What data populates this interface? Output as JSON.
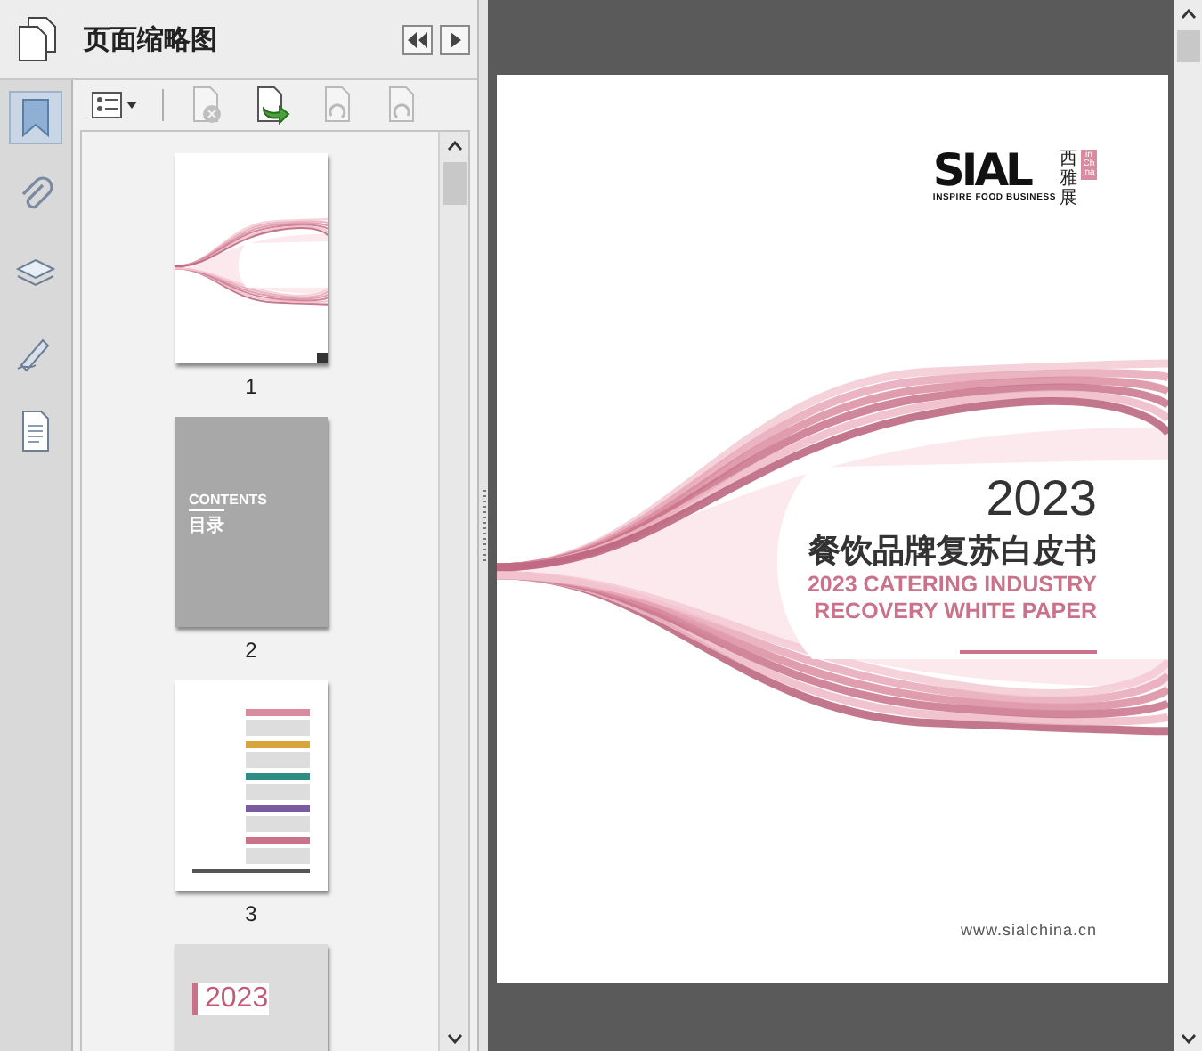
{
  "panel": {
    "title": "页面缩略图"
  },
  "side_tools": [
    {
      "kind": "bookmark",
      "selected": true
    },
    {
      "kind": "attachment",
      "selected": false
    },
    {
      "kind": "layers",
      "selected": false
    },
    {
      "kind": "signature",
      "selected": false
    },
    {
      "kind": "document",
      "selected": false
    }
  ],
  "thumb_tools": [
    {
      "kind": "delete",
      "disabled": true
    },
    {
      "kind": "insert",
      "disabled": false
    },
    {
      "kind": "rotate-left",
      "disabled": true
    },
    {
      "kind": "rotate-right",
      "disabled": true
    }
  ],
  "thumbnails": [
    {
      "kind": "cover",
      "label": "1",
      "selected": true
    },
    {
      "kind": "contents",
      "label": "2",
      "selected": false,
      "heading": "CONTENTS",
      "subheading": "目录"
    },
    {
      "kind": "toc",
      "label": "3",
      "selected": false
    },
    {
      "kind": "section",
      "year": "2023"
    }
  ],
  "document": {
    "logo": {
      "brand": "SIAL",
      "tagline": "INSPIRE FOOD BUSINESS",
      "chinese": "西雅展",
      "badge": "in China"
    },
    "year": "2023",
    "title": "餐饮品牌复苏白皮书",
    "subtitle_lines": [
      "2023 CATERING INDUSTRY",
      "RECOVERY WHITE PAPER"
    ],
    "url": "www.sialchina.cn"
  }
}
